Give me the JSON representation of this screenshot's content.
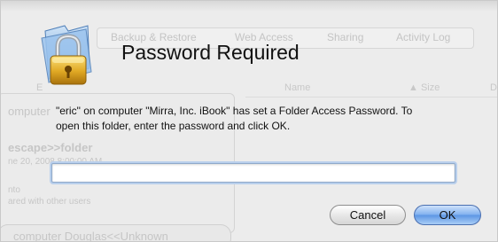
{
  "background": {
    "tabs": [
      "Backup & Restore",
      "Web Access",
      "Sharing",
      "Activity Log"
    ],
    "columns": {
      "name": "Name",
      "size": "Size",
      "date_initial": "D",
      "left_initial": "E"
    },
    "left_panel": {
      "computer_prefix": "omputer",
      "folder_text": "escape>>folder",
      "date_text": "ne 20, 2008 8:00:00 AM",
      "label_small": "nto",
      "shared_text": "ared with other users",
      "bottom_item": "computer Douglas<<Unknown"
    }
  },
  "dialog": {
    "title": "Password Required",
    "message": "\"eric\" on computer \"Mirra, Inc. iBook\" has set a Folder Access Password. To open this folder, enter the password and click OK.",
    "password_value": "",
    "password_placeholder": "",
    "cancel_label": "Cancel",
    "ok_label": "OK",
    "icon": "folder-lock-icon"
  },
  "colors": {
    "default_button": "#6fa6ec",
    "field_focus": "#b9cfec",
    "lock_gold": "#e4b52c",
    "folder_blue": "#7fb0e6"
  }
}
